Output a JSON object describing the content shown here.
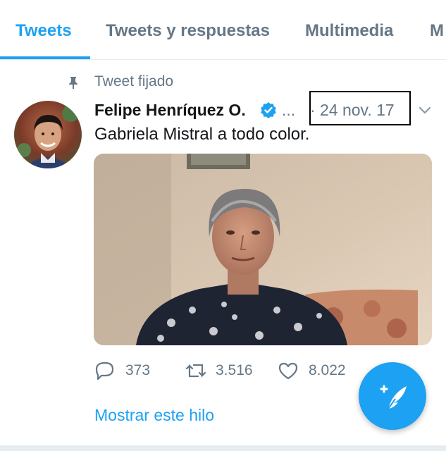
{
  "tabs": [
    {
      "label": "Tweets",
      "active": true
    },
    {
      "label": "Tweets y respuestas",
      "active": false
    },
    {
      "label": "Multimedia",
      "active": false
    },
    {
      "label": "M",
      "active": false
    }
  ],
  "pinned": {
    "label": "Tweet fijado",
    "icon": "pin-icon"
  },
  "tweet": {
    "author": "Felipe Henríquez O.",
    "verified": true,
    "ellipsis": "...",
    "separator": "·",
    "date": "24 nov. 17",
    "text": "Gabriela Mistral a todo color.",
    "actions": {
      "replies": "373",
      "retweets": "3.516",
      "likes": "8.022"
    },
    "show_thread": "Mostrar este hilo"
  },
  "colors": {
    "accent": "#1da1f2",
    "muted": "#657786",
    "text": "#14171a"
  }
}
